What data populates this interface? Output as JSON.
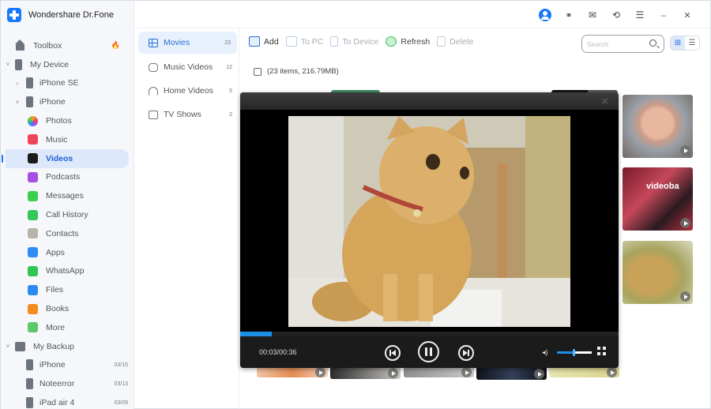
{
  "app": {
    "title": "Wondershare Dr.Fone"
  },
  "titlebar": {
    "icons": [
      "account-icon",
      "headset-icon",
      "mail-icon",
      "history-icon",
      "menu-icon",
      "minimize-icon",
      "close-icon"
    ],
    "minimize_glyph": "–",
    "close_glyph": "✕",
    "menu_glyph": "☰",
    "mail_glyph": "✉",
    "history_glyph": "⟲",
    "headset_glyph": "🎧"
  },
  "sidebar": {
    "items": [
      {
        "label": "Toolbox",
        "icon": "home-icon",
        "badge": "🔥"
      },
      {
        "label": "My Device",
        "icon": "device-icon",
        "chevron": "˅"
      },
      {
        "label": "iPhone SE",
        "icon": "phone-icon",
        "chevron": "›"
      },
      {
        "label": "iPhone",
        "icon": "phone-icon",
        "chevron": "˅"
      },
      {
        "label": "Photos",
        "icon": "photos-icon",
        "color": "#f5a623"
      },
      {
        "label": "Music",
        "icon": "music-icon",
        "color": "#f0445a"
      },
      {
        "label": "Videos",
        "icon": "apple-tv-icon",
        "color": "#1c1c1c",
        "active": true
      },
      {
        "label": "Podcasts",
        "icon": "podcasts-icon",
        "color": "#a64fe0"
      },
      {
        "label": "Messages",
        "icon": "messages-icon",
        "color": "#3ccf4e"
      },
      {
        "label": "Call History",
        "icon": "phone-call-icon",
        "color": "#34c759"
      },
      {
        "label": "Contacts",
        "icon": "contacts-icon",
        "color": "#b8b2a8"
      },
      {
        "label": "Apps",
        "icon": "app-store-icon",
        "color": "#2f8cf5"
      },
      {
        "label": "WhatsApp",
        "icon": "whatsapp-icon",
        "color": "#2fc651"
      },
      {
        "label": "Files",
        "icon": "files-icon",
        "color": "#2a8cf0"
      },
      {
        "label": "Books",
        "icon": "books-icon",
        "color": "#f58a1f"
      },
      {
        "label": "More",
        "icon": "more-icon",
        "color": "#5ac86b"
      },
      {
        "label": "My Backup",
        "icon": "backup-icon",
        "chevron": "˅"
      },
      {
        "label": "iPhone",
        "icon": "phone-icon",
        "date": "03/15"
      },
      {
        "label": "Noteerror",
        "icon": "phone-icon",
        "date": "03/13"
      },
      {
        "label": "iPad air 4",
        "icon": "phone-icon",
        "date": "03/09"
      }
    ]
  },
  "categories": [
    {
      "label": "Movies",
      "count": "23",
      "icon": "film-icon",
      "active": true
    },
    {
      "label": "Music Videos",
      "count": "12",
      "icon": "music-video-icon"
    },
    {
      "label": "Home Videos",
      "count": "5",
      "icon": "home-video-icon"
    },
    {
      "label": "TV Shows",
      "count": "2",
      "icon": "tv-icon"
    }
  ],
  "toolbar": {
    "add": "Add",
    "to_pc": "To PC",
    "to_device": "To Device",
    "refresh": "Refresh",
    "delete": "Delete"
  },
  "search": {
    "placeholder": "Search",
    "value": ""
  },
  "view_toggle": {
    "grid_glyph": "⊞",
    "list_glyph": "☰",
    "active": "grid"
  },
  "selection": {
    "summary": "(23 items, 216.79MB)"
  },
  "player": {
    "close_glyph": "✕",
    "time": "00:03/00:36",
    "progress": 0.083,
    "volume": 0.5,
    "volume_glyph": "🔈"
  },
  "accent_color": "#1677ff"
}
